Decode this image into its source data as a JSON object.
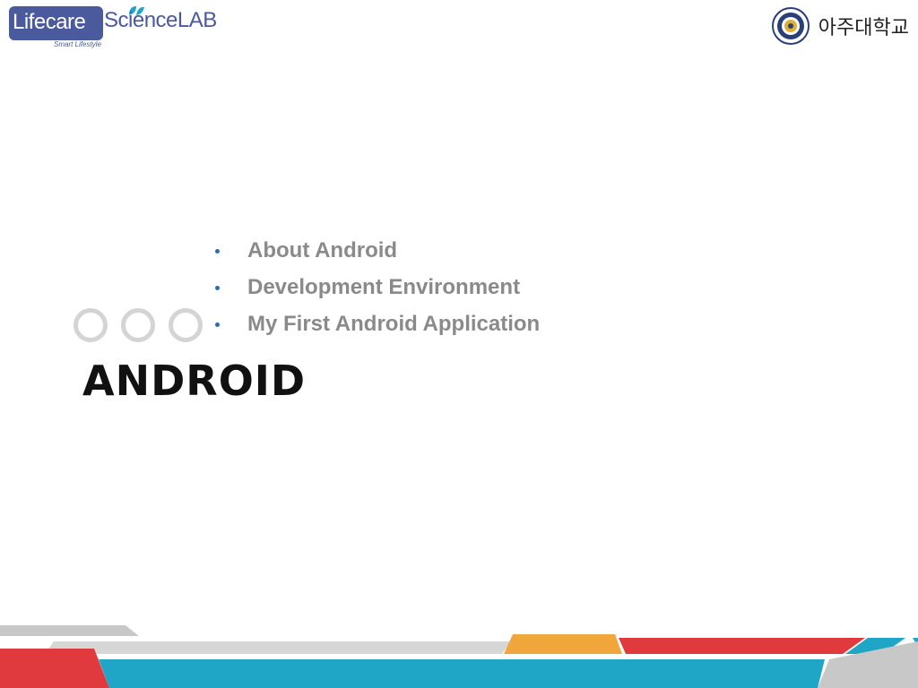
{
  "header": {
    "lab_logo": {
      "part1": "Lifecare",
      "part2": "ScienceLAB",
      "tagline": "Smart Lifestyle"
    },
    "university": "아주대학교"
  },
  "bullets": [
    "About Android",
    "Development Environment",
    "My First Android Application"
  ],
  "title": "ANDROID",
  "colors": {
    "brand_blue": "#4a5a9c",
    "bullet_dot": "#2f6bb0",
    "stripe_gray": "#c8c8c8",
    "stripe_red": "#e03a3e",
    "stripe_orange": "#f0a63a",
    "stripe_blue": "#1fa6c7"
  }
}
